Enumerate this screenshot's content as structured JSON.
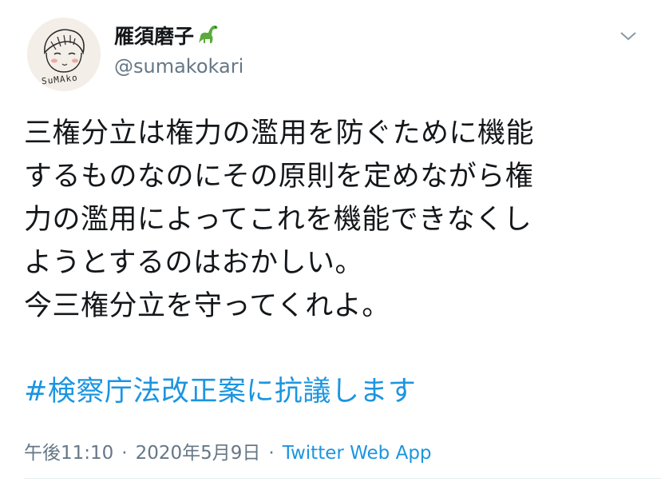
{
  "user": {
    "display_name": "雁須磨子",
    "handle": "@sumakokari",
    "avatar_label": "SuMAko",
    "name_emoji_icon": "sauropod-icon"
  },
  "tweet": {
    "lines": [
      "三権分立は権力の濫用を防ぐために機能",
      "するものなのにその原則を定めながら権",
      "力の濫用によってこれを機能できなくし",
      "ようとするのはおかしい。",
      "今三権分立を守ってくれよ。"
    ],
    "hashtag": "#検察庁法改正案に抗議します"
  },
  "meta": {
    "time": "午後11:10",
    "separator": "·",
    "date": "2020年5月9日",
    "source": "Twitter Web App"
  },
  "colors": {
    "text": "#14171a",
    "secondary": "#657786",
    "link": "#1b95e0",
    "divider": "#e6ecf0"
  }
}
